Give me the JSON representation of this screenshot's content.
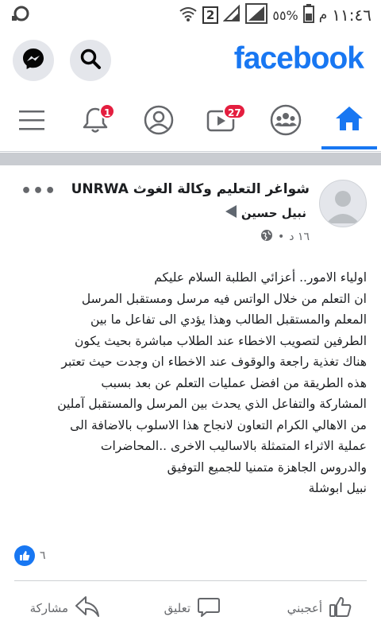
{
  "status_bar": {
    "time": "١١:٤٦",
    "am_pm": "م",
    "battery_percent": "٥٥%",
    "sim_number": "2"
  },
  "header": {
    "logo": "facebook",
    "brand_color": "#1877f2"
  },
  "tabs": {
    "notifications_badge": "1",
    "watch_badge": "27",
    "active": "home"
  },
  "post": {
    "group_name": "شواغر التعليم وكالة الغوث UNRWA",
    "author": "نبيل حسين",
    "time": "١٦ د",
    "privacy_icon": "globe-icon",
    "body_lines": [
      "اولياء الامور.. أعزائي الطلبة السلام عليكم",
      "ان التعلم  من خلال  الواتس فيه مرسل ومستقبل المرسل",
      "المعلم والمستقبل الطالب وهذا يؤدي الى تفاعل ما بين",
      "الطرفين لتصويب الاخطاء عند الطلاب مباشرة  بحيث يكون",
      "هناك تغذية راجعة والوقوف عند الاخطاء ان وجدت  حيث تعتبر",
      "هذه الطريقة من افضل عمليات التعلم عن بعد بسبب",
      "المشاركة والتفاعل الذي يحدث بين المرسل والمستقبل آملين",
      "من الاهالي الكرام التعاون لانجاح هذا الاسلوب بالاضافة الى",
      "عملية الاثراء المتمثلة بالاساليب الاخرى ..المحاضرات",
      "والدروس الجاهزة  متمنيا للجميع التوفيق",
      "نبيل ابوشلة"
    ],
    "like_count": "٦"
  },
  "actions": {
    "like": "أعجبني",
    "comment": "تعليق",
    "share": "مشاركة"
  }
}
